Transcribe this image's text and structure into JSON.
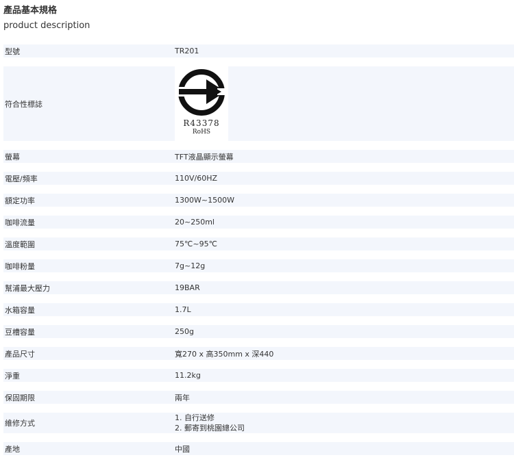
{
  "header": {
    "title": "產品基本規格",
    "subtitle": "product description"
  },
  "specs": [
    {
      "label": "型號",
      "value": "TR201"
    },
    {
      "label": "符合性標誌",
      "logo": {
        "code": "R43378",
        "rohs": "RoHS",
        "icon": "bsmi-certification-mark-icon"
      }
    },
    {
      "label": "螢幕",
      "value": "TFT液晶顯示螢幕"
    },
    {
      "label": "電壓/頻率",
      "value": "110V/60HZ"
    },
    {
      "label": "額定功率",
      "value": "1300W~1500W"
    },
    {
      "label": "咖啡流量",
      "value": "20~250ml"
    },
    {
      "label": "溫度範圍",
      "value": "75℃~95℃"
    },
    {
      "label": "咖啡粉量",
      "value": "7g~12g"
    },
    {
      "label": "幫浦最大壓力",
      "value": "19BAR"
    },
    {
      "label": "水箱容量",
      "value": "1.7L"
    },
    {
      "label": "豆槽容量",
      "value": "250g"
    },
    {
      "label": "產品尺寸",
      "value": "寬270 x 高350mm x 深440"
    },
    {
      "label": "淨重",
      "value": "11.2kg"
    },
    {
      "label": "保固期限",
      "value": "兩年"
    },
    {
      "label": "維修方式",
      "lines": [
        "1. 自行送修",
        "2. 郵寄到桃園總公司"
      ]
    },
    {
      "label": "產地",
      "value": "中國"
    }
  ],
  "colors": {
    "row_background": "#f3f6fc",
    "text": "#333333"
  }
}
